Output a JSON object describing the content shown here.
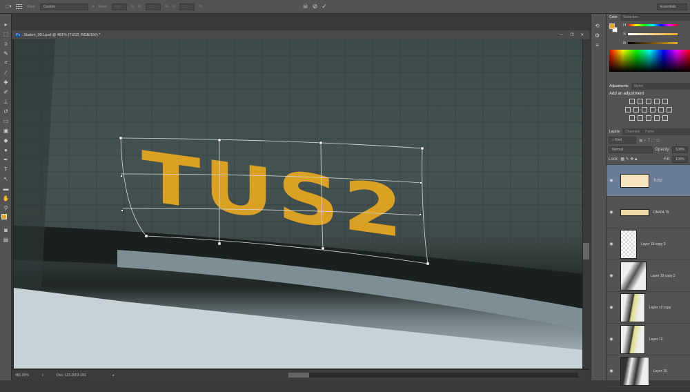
{
  "options_bar": {
    "warp_label": "Warp:",
    "warp_value": "Custom",
    "bend_label": "Bend:",
    "bend_value": "0.0",
    "h_label": "H:",
    "h_value": "0.0",
    "v_label": "V:",
    "v_value": "0.0",
    "percent": "%",
    "workspace": "Essentials"
  },
  "document": {
    "tab_title": "Station_001.psd @ 481% (TUS2, RGB/16#) *",
    "canvas_text": "TUS2"
  },
  "status_bar": {
    "zoom": "481.25%",
    "doc_size": "Doc: 123.2M/3.19G"
  },
  "color_panel": {
    "tabs": [
      "Color",
      "Swatches"
    ],
    "h_label": "H",
    "s_label": "S",
    "b_label": "B",
    "fg_color": "#e8a820"
  },
  "adjustments_panel": {
    "tabs": [
      "Adjustments",
      "Styles"
    ],
    "heading": "Add an adjustment"
  },
  "layers_panel": {
    "tabs": [
      "Layers",
      "Channels",
      "Paths"
    ],
    "filter": "Kind",
    "blend_mode": "Normal",
    "opacity_label": "Opacity:",
    "opacity": "100%",
    "lock_label": "Lock:",
    "fill_label": "Fill:",
    "fill": "100%",
    "layers": [
      {
        "name": "TUS2",
        "selected": true
      },
      {
        "name": "DN404.79",
        "selected": false
      },
      {
        "name": "Layer 19 copy 3",
        "selected": false
      },
      {
        "name": "Layer 19 copy 2",
        "selected": false
      },
      {
        "name": "Layer 19 copy",
        "selected": false
      },
      {
        "name": "Layer 19",
        "selected": false
      },
      {
        "name": "Layer 15",
        "selected": false
      }
    ]
  }
}
